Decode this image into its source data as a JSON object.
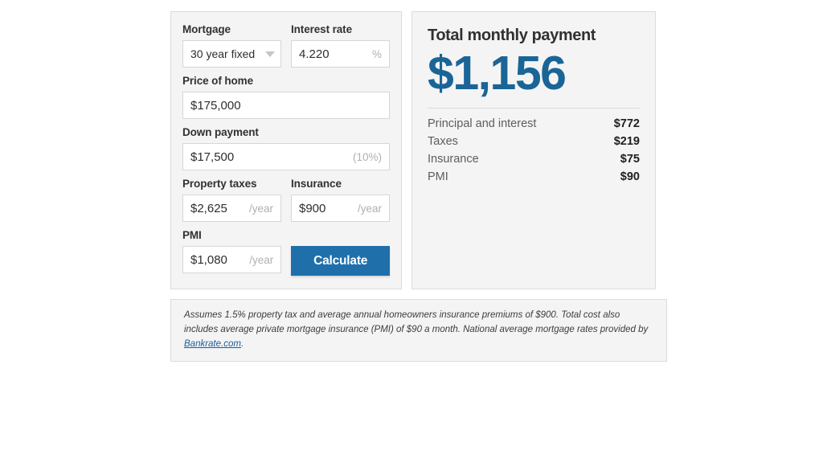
{
  "form": {
    "mortgage": {
      "label": "Mortgage",
      "value": "30 year fixed",
      "options": [
        "30 year fixed"
      ],
      "icon": "chevron-down-icon"
    },
    "interest_rate": {
      "label": "Interest rate",
      "value": "4.220",
      "suffix": "%"
    },
    "price_of_home": {
      "label": "Price of home",
      "value": "$175,000"
    },
    "down_payment": {
      "label": "Down payment",
      "value": "$17,500",
      "suffix": "(10%)"
    },
    "property_taxes": {
      "label": "Property taxes",
      "value": "$2,625",
      "suffix": "/year"
    },
    "insurance": {
      "label": "Insurance",
      "value": "$900",
      "suffix": "/year"
    },
    "pmi": {
      "label": "PMI",
      "value": "$1,080",
      "suffix": "/year"
    },
    "calculate_label": "Calculate"
  },
  "results": {
    "title": "Total monthly payment",
    "total": "$1,156",
    "breakdown": [
      {
        "label": "Principal and interest",
        "value": "$772"
      },
      {
        "label": "Taxes",
        "value": "$219"
      },
      {
        "label": "Insurance",
        "value": "$75"
      },
      {
        "label": "PMI",
        "value": "$90"
      }
    ]
  },
  "footer": {
    "text_before": "Assumes 1.5% property tax and average annual homeowners insurance premiums of $900. Total cost also includes average private mortgage insurance (PMI) of $90 a month. National average mortgage rates provided by ",
    "link_text": "Bankrate.com",
    "text_after": "."
  },
  "colors": {
    "accent_button": "#1f6fab",
    "accent_total": "#1a6596",
    "panel_background": "#f4f4f5",
    "panel_border": "#dcdcdc",
    "link": "#1a5c96"
  }
}
